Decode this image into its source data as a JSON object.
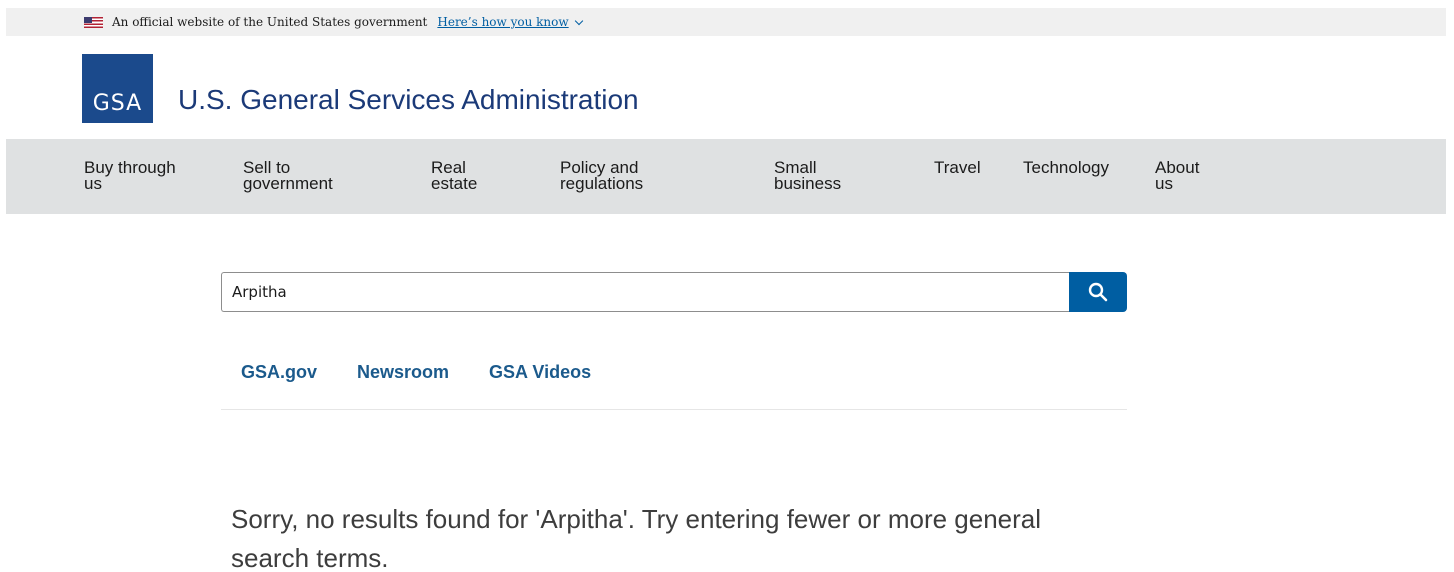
{
  "banner": {
    "text": "An official website of the United States government",
    "link": "Here’s how you know"
  },
  "header": {
    "logo_text": "GSA",
    "title": "U.S. General Services Administration"
  },
  "nav": {
    "items": [
      {
        "label": "Buy through\nus"
      },
      {
        "label": "Sell to\ngovernment"
      },
      {
        "label": "Real\nestate"
      },
      {
        "label": "Policy and\nregulations"
      },
      {
        "label": "Small\nbusiness"
      },
      {
        "label": "Travel"
      },
      {
        "label": "Technology"
      },
      {
        "label": "About\nus"
      }
    ]
  },
  "search": {
    "value": "Arpitha",
    "button_icon": "search-icon"
  },
  "tabs": [
    {
      "label": "GSA.gov"
    },
    {
      "label": "Newsroom"
    },
    {
      "label": "GSA Videos"
    }
  ],
  "results": {
    "message": "Sorry, no results found for 'Arpitha'. Try entering fewer or more general search terms."
  },
  "colors": {
    "brand_blue": "#1b4a8c",
    "link_blue": "#005ea2",
    "nav_bg": "#dfe1e2"
  }
}
